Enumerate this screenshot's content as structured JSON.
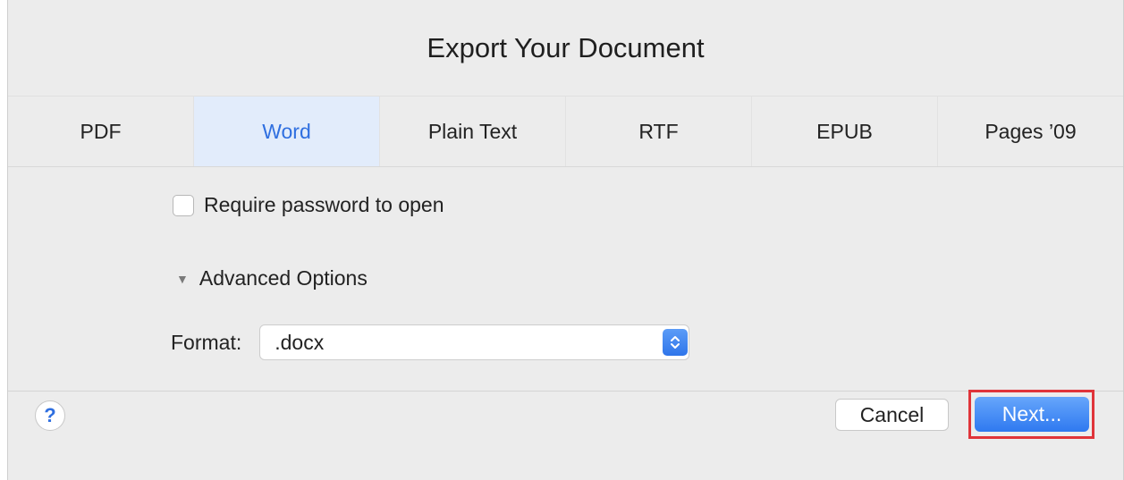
{
  "dialog": {
    "title": "Export Your Document",
    "tabs": [
      {
        "label": "PDF",
        "selected": false
      },
      {
        "label": "Word",
        "selected": true
      },
      {
        "label": "Plain Text",
        "selected": false
      },
      {
        "label": "RTF",
        "selected": false
      },
      {
        "label": "EPUB",
        "selected": false
      },
      {
        "label": "Pages ’09",
        "selected": false
      }
    ],
    "password": {
      "label": "Require password to open",
      "checked": false
    },
    "advanced": {
      "label": "Advanced Options",
      "expanded": true
    },
    "format": {
      "label": "Format:",
      "value": ".docx"
    },
    "help_label": "?",
    "buttons": {
      "cancel": "Cancel",
      "next": "Next..."
    }
  },
  "colors": {
    "accent": "#2f6fe0",
    "selected_tab_bg": "#e2ecfb",
    "highlight_border": "#e0343a"
  },
  "icons": {
    "help": "help-icon",
    "disclosure": "disclosure-triangle-icon",
    "stepper": "select-stepper-icon"
  }
}
